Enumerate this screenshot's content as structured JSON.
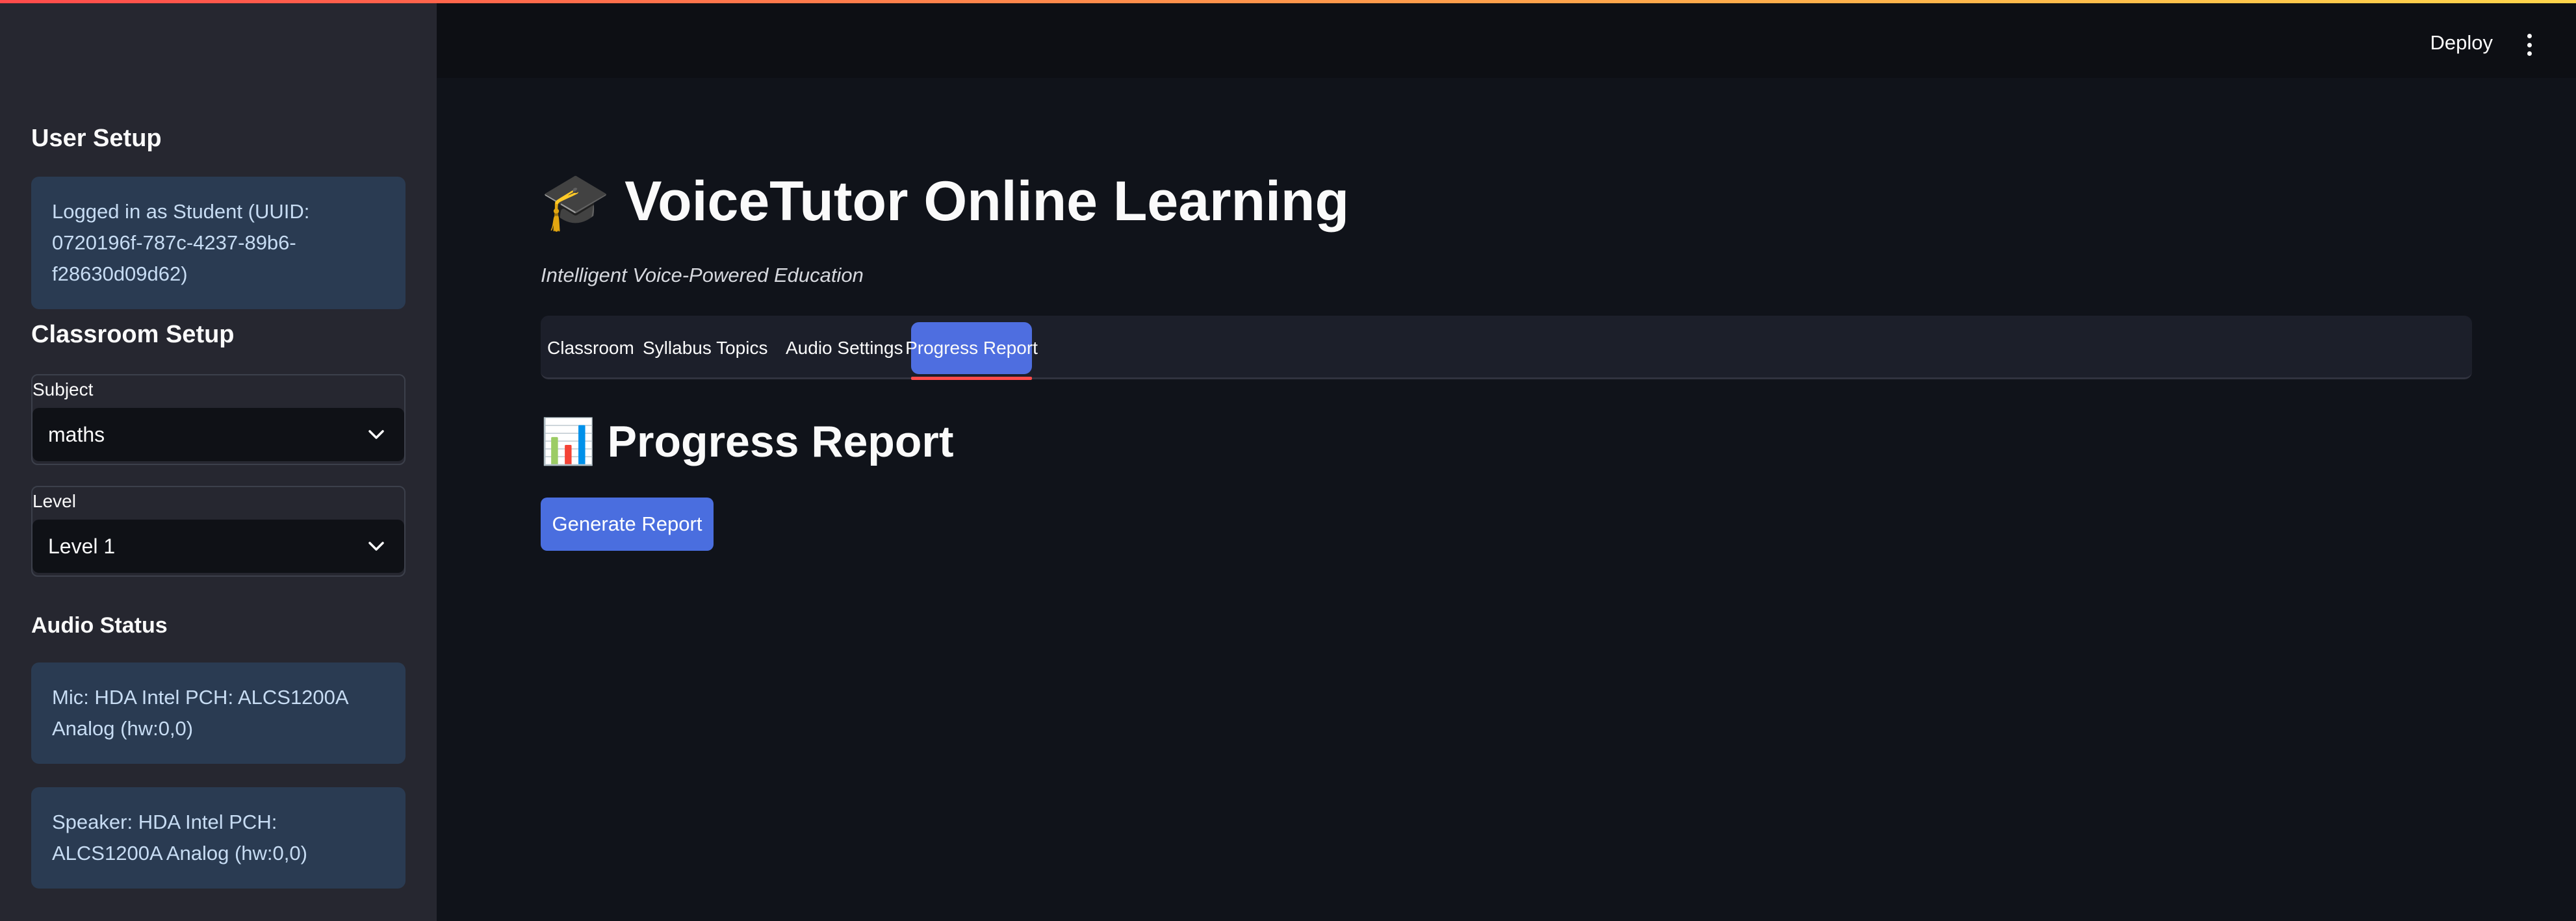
{
  "header": {
    "deploy_label": "Deploy",
    "menu_icon": "kebab-menu-icon"
  },
  "sidebar": {
    "user_setup": {
      "heading": "User Setup",
      "login_info": "Logged in as Student (UUID: 0720196f-787c-4237-89b6-f28630d09d62)"
    },
    "classroom_setup": {
      "heading": "Classroom Setup",
      "subject": {
        "label": "Subject",
        "value": "maths"
      },
      "level": {
        "label": "Level",
        "value": "Level 1"
      }
    },
    "audio_status": {
      "heading": "Audio Status",
      "mic": "Mic: HDA Intel PCH: ALCS1200A Analog (hw:0,0)",
      "speaker": "Speaker: HDA Intel PCH: ALCS1200A Analog (hw:0,0)"
    }
  },
  "main": {
    "title_icon": "🎓",
    "title": "VoiceTutor Online Learning",
    "subtitle": "Intelligent Voice-Powered Education",
    "tabs": [
      {
        "label": "Classroom",
        "active": false
      },
      {
        "label": "Syllabus Topics",
        "active": false
      },
      {
        "label": "Audio Settings",
        "active": false
      },
      {
        "label": "Progress Report",
        "active": true
      }
    ],
    "section_icon": "📊",
    "section_title": "Progress Report",
    "generate_button": "Generate Report"
  },
  "colors": {
    "accent": "#4a6edf",
    "active_tab_underline": "#ff4b4b",
    "sidebar_bg": "#262730",
    "main_bg": "#10131a",
    "info_box_bg": "#2a3b52"
  }
}
